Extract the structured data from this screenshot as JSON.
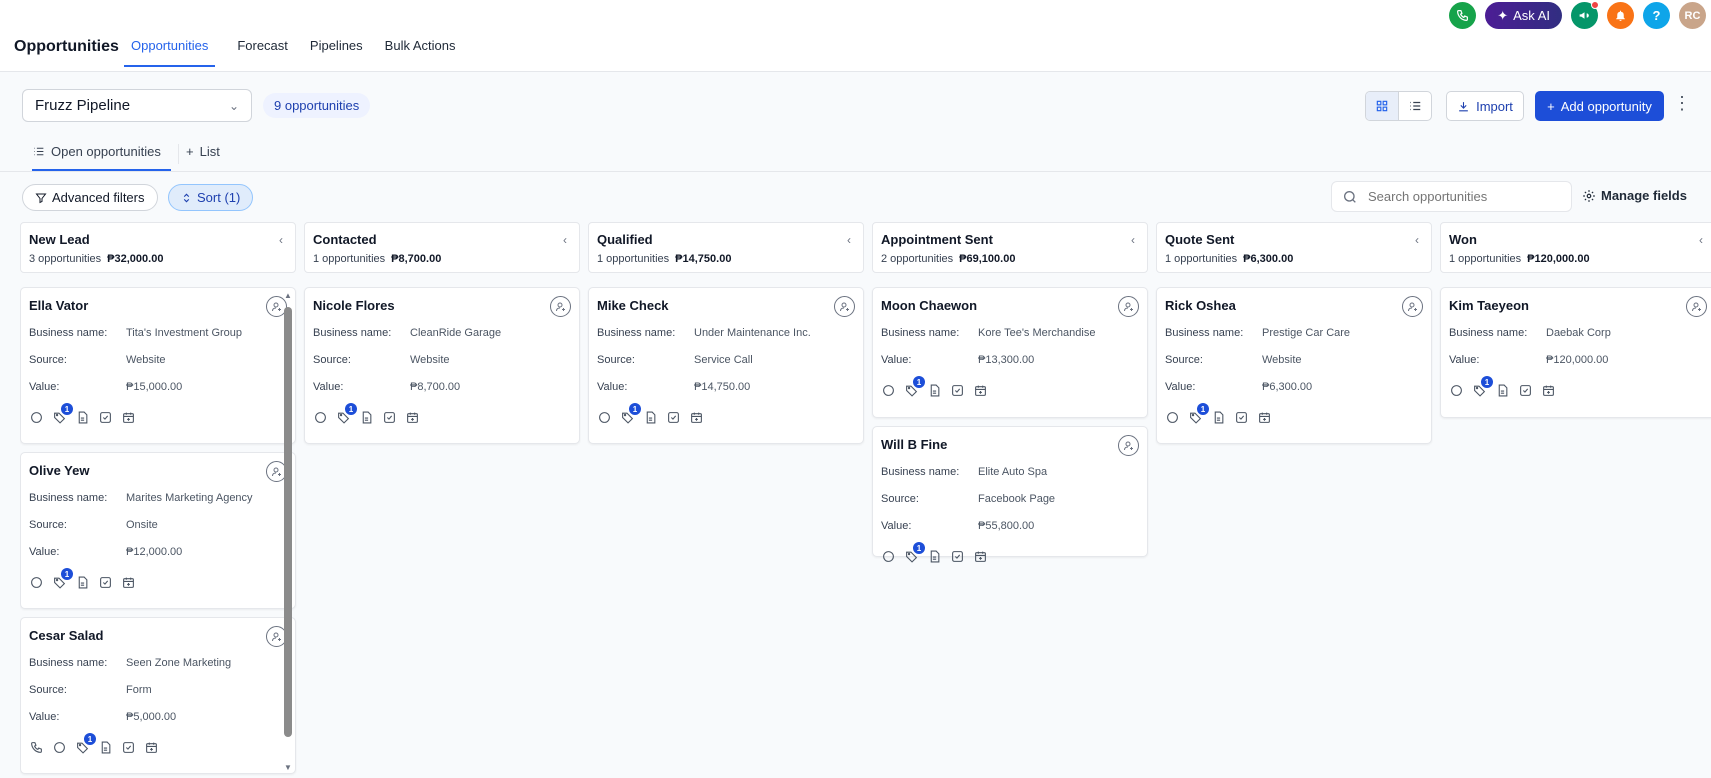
{
  "app": {
    "title": "Opportunities"
  },
  "top_tabs": [
    {
      "label": "Opportunities",
      "active": true
    },
    {
      "label": "Forecast"
    },
    {
      "label": "Pipelines"
    },
    {
      "label": "Bulk Actions"
    }
  ],
  "top_icons": {
    "ask_ai": "Ask AI",
    "help": "?",
    "avatar_initials": "RC"
  },
  "toolbar": {
    "pipeline": "Fruzz Pipeline",
    "opportunity_count": "9 opportunities",
    "import_label": "Import",
    "add_label": "Add opportunity"
  },
  "subtabs": {
    "open": "Open opportunities",
    "list": "List"
  },
  "filters": {
    "advanced": "Advanced filters",
    "sort": "Sort (1)",
    "search_placeholder": "Search opportunities",
    "manage_fields": "Manage fields"
  },
  "labels": {
    "business": "Business name:",
    "source": "Source:",
    "value": "Value:"
  },
  "columns": [
    {
      "title": "New Lead",
      "count": "3 opportunities",
      "total": "₱32,000.00",
      "cards": [
        {
          "name": "Ella Vator",
          "business": "Tita's Investment Group",
          "source": "Website",
          "value": "₱15,000.00",
          "badge": "1"
        },
        {
          "name": "Olive Yew",
          "business": "Marites Marketing Agency",
          "source": "Onsite",
          "value": "₱12,000.00",
          "badge": "1"
        },
        {
          "name": "Cesar Salad",
          "business": "Seen Zone Marketing",
          "source": "Form",
          "value": "₱5,000.00",
          "badge": "1",
          "phone": true
        }
      ]
    },
    {
      "title": "Contacted",
      "count": "1 opportunities",
      "total": "₱8,700.00",
      "cards": [
        {
          "name": "Nicole Flores",
          "business": "CleanRide Garage",
          "source": "Website",
          "value": "₱8,700.00",
          "badge": "1"
        }
      ]
    },
    {
      "title": "Qualified",
      "count": "1 opportunities",
      "total": "₱14,750.00",
      "cards": [
        {
          "name": "Mike Check",
          "business": "Under Maintenance Inc.",
          "source": "Service Call",
          "value": "₱14,750.00",
          "badge": "1"
        }
      ]
    },
    {
      "title": "Appointment Sent",
      "count": "2 opportunities",
      "total": "₱69,100.00",
      "cards": [
        {
          "name": "Moon Chaewon",
          "business": "Kore Tee's Merchandise",
          "value": "₱13,300.00",
          "badge": "1"
        },
        {
          "name": "Will B Fine",
          "business": "Elite Auto Spa",
          "source": "Facebook Page",
          "value": "₱55,800.00",
          "badge": "1"
        }
      ]
    },
    {
      "title": "Quote Sent",
      "count": "1 opportunities",
      "total": "₱6,300.00",
      "cards": [
        {
          "name": "Rick Oshea",
          "business": "Prestige Car Care",
          "source": "Website",
          "value": "₱6,300.00",
          "badge": "1"
        }
      ]
    },
    {
      "title": "Won",
      "count": "1 opportunities",
      "total": "₱120,000.00",
      "cards": [
        {
          "name": "Kim Taeyeon",
          "business": "Daebak Corp",
          "value": "₱120,000.00",
          "badge": "1"
        }
      ]
    }
  ]
}
